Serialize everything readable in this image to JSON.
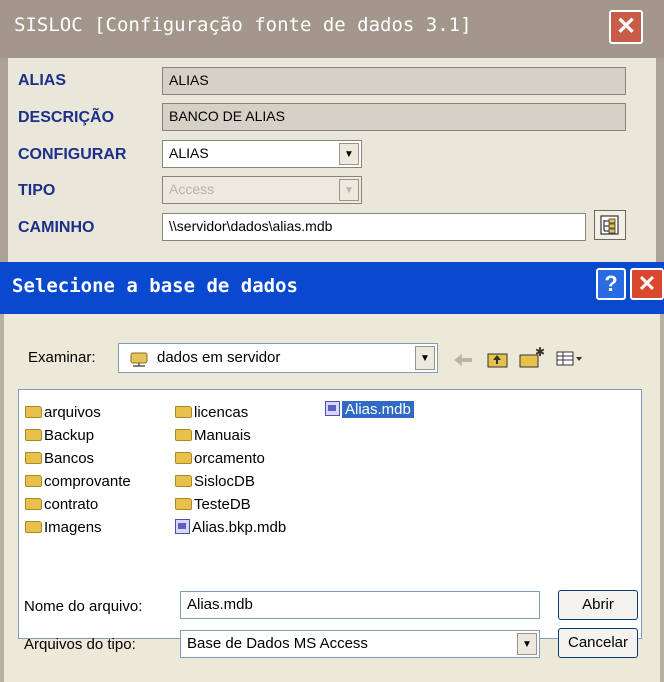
{
  "back_window": {
    "title": "SISLOC [Configuração fonte de dados 3.1]",
    "close_glyph": "✕",
    "fields": {
      "alias_label": "ALIAS",
      "alias_value": "ALIAS",
      "descricao_label": "DESCRIÇÃO",
      "descricao_value": "BANCO DE ALIAS",
      "configurar_label": "CONFIGURAR",
      "configurar_value": "ALIAS",
      "tipo_label": "TIPO",
      "tipo_value": "Access",
      "caminho_label": "CAMINHO",
      "caminho_value": "\\\\servidor\\dados\\alias.mdb"
    }
  },
  "dialog": {
    "title": "Selecione a base de dados",
    "help_glyph": "?",
    "close_glyph": "✕",
    "look_in_label": "Examinar:",
    "look_in_value": "dados em servidor",
    "toolbar": {
      "back_icon": "back-arrow-icon",
      "up_icon": "up-folder-icon",
      "new_folder_icon": "new-folder-icon",
      "view_icon": "view-menu-icon"
    },
    "files": {
      "col1": [
        "arquivos",
        "Backup",
        "Bancos",
        "comprovante",
        "contrato",
        "Imagens"
      ],
      "col2_folders": [
        "licencas",
        "Manuais",
        "orcamento",
        "SislocDB",
        "TesteDB"
      ],
      "col2_file": "Alias.bkp.mdb",
      "col3_selected": "Alias.mdb"
    },
    "filename_label": "Nome do arquivo:",
    "filename_value": "Alias.mdb",
    "filetype_label": "Arquivos do tipo:",
    "filetype_value": "Base de Dados MS Access",
    "open_button": "Abrir",
    "cancel_button": "Cancelar"
  },
  "colors": {
    "dialog_title_bar": "#0849d0",
    "back_title_bar": "#a3968b",
    "label_blue": "#1c2f8a",
    "selection": "#316ac5"
  }
}
